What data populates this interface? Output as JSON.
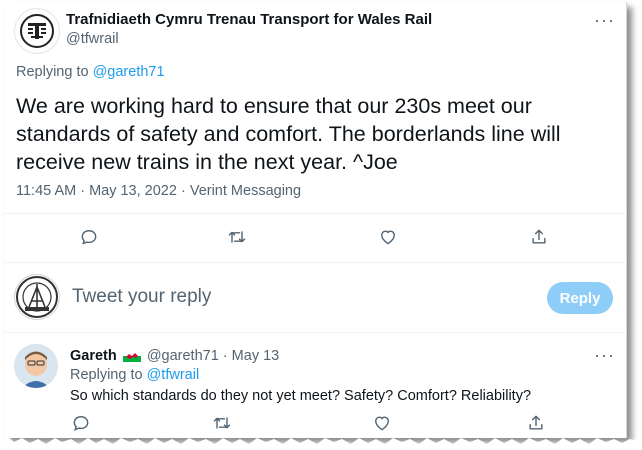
{
  "tweet": {
    "author_name": "Trafnidiaeth Cymru Trenau Transport for Wales Rail",
    "author_handle": "@tfwrail",
    "more_label": "···",
    "replying_prefix": "Replying to ",
    "replying_handle": "@gareth71",
    "text": "We are working hard to ensure that our 230s meet our standards of safety and comfort. The borderlands line will receive new trains in the next year. ^Joe",
    "timestamp": "11:45 AM · May 13, 2022 · Verint Messaging",
    "actions": [
      "reply-icon",
      "retweet-icon",
      "like-icon",
      "share-icon"
    ]
  },
  "compose": {
    "placeholder": "Tweet your reply",
    "button_label": "Reply",
    "button_color": "#8ecdf8"
  },
  "reply": {
    "author_name": "Gareth",
    "flag_icon": "wales-flag-icon",
    "handle": "@gareth71",
    "separator": " · ",
    "date": "May 13",
    "more_label": "···",
    "replying_prefix": "Replying to ",
    "replying_handle": "@tfwrail",
    "text": "So which standards do they not yet meet? Safety? Comfort? Reliability?"
  },
  "colors": {
    "link": "#1d9bf0",
    "secondary_text": "#536471",
    "primary_text": "#0f1419"
  }
}
